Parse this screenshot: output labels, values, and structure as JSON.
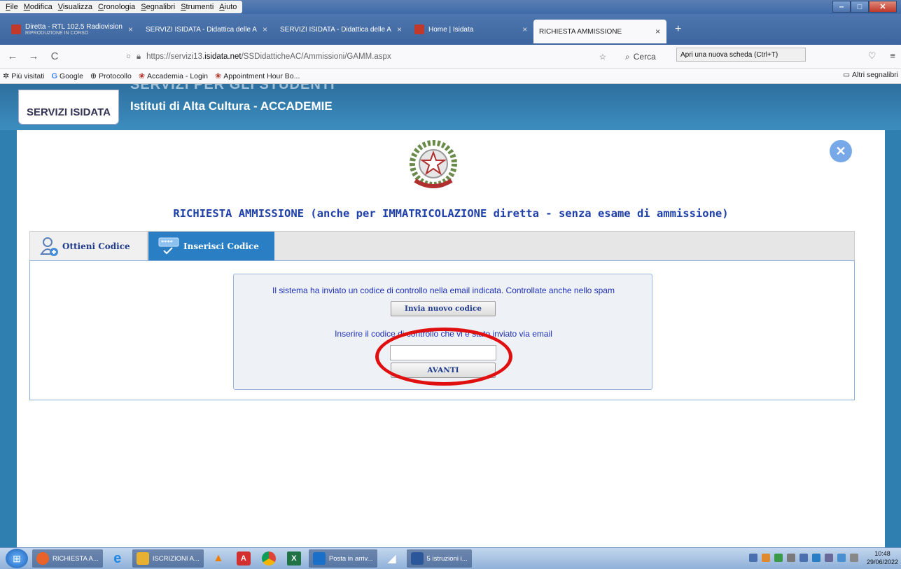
{
  "menu": [
    "File",
    "Modifica",
    "Visualizza",
    "Cronologia",
    "Segnalibri",
    "Strumenti",
    "Aiuto"
  ],
  "tabs": [
    {
      "label": "Diretta - RTL 102.5 Radiovision",
      "sub": "RIPRODUZIONE IN CORSO",
      "color": "#c0392b"
    },
    {
      "label": "SERVIZI ISIDATA - Didattica delle A",
      "sub": "",
      "color": ""
    },
    {
      "label": "SERVIZI ISIDATA - Didattica delle A",
      "sub": "",
      "color": ""
    },
    {
      "label": "Home | Isidata",
      "sub": "",
      "color": "#c0392b"
    },
    {
      "label": "RICHIESTA AMMISSIONE",
      "sub": "",
      "color": ""
    }
  ],
  "url": {
    "prefix": "https://servizi13.",
    "host": "isidata.net",
    "path": "/SSDidatticheAC/Ammissioni/GAMM.aspx"
  },
  "search_placeholder": "Cerca",
  "tooltip": "Apri una nuova scheda (Ctrl+T)",
  "bookmarks": [
    "Più visitati",
    "Google",
    "Protocollo",
    "Accademia - Login",
    "Appointment Hour Bo..."
  ],
  "bookmarks_other": "Altri segnalibri",
  "site": {
    "faded_header": "SERVIZI PER GLI STUDENTI",
    "logo_text": "SERVIZI ISIDATA",
    "header_title": "Istituti di Alta Cultura - ACCADEMIE"
  },
  "form": {
    "title": "RICHIESTA AMMISSIONE (anche per IMMATRICOLAZIONE diretta - senza esame di ammissione)",
    "tab_get_code": "Ottieni Codice",
    "tab_insert_code": "Inserisci Codice",
    "message": "Il sistema ha inviato un codice di controllo nella email indicata. Controllate anche nello spam",
    "resend_button": "Invia nuovo codice",
    "code_label": "Inserire il codice di controllo che vi è stato inviato via email",
    "code_value": "",
    "next_button": "AVANTI"
  },
  "taskbar": [
    {
      "label": "RICHIESTA A...",
      "color": "#e8622a"
    },
    {
      "label": "ISCRIZIONI A...",
      "color": "#e8b030"
    },
    {
      "label": "Posta in arriv...",
      "color": "#1a6fc9"
    },
    {
      "label": "5 istruzioni i...",
      "color": "#2b579a"
    }
  ],
  "clock": {
    "time": "10:48",
    "date": "29/06/2022"
  }
}
